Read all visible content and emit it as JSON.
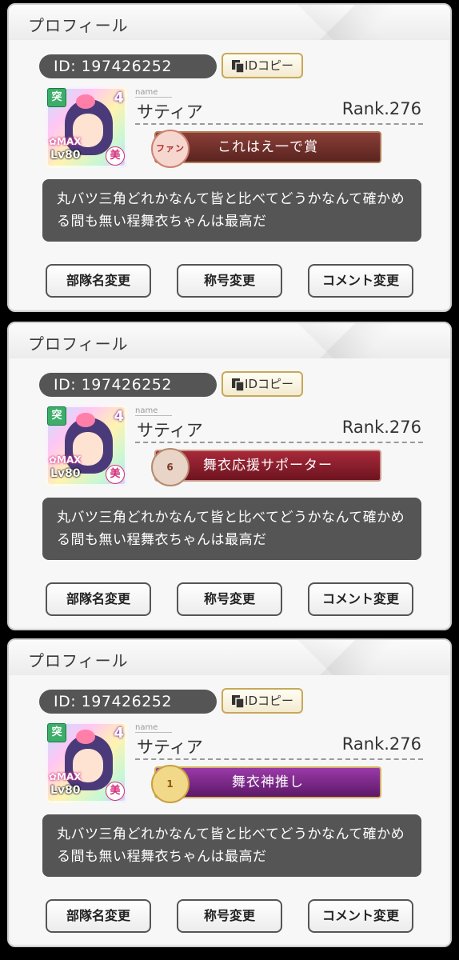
{
  "panels": [
    {
      "title": "プロフィール",
      "id_text": "ID: 197426252",
      "copy_label": "IDコピー",
      "name_caption": "name",
      "player_name": "サティア",
      "rank": "Rank.276",
      "badge_top": "突",
      "badge_num": "4",
      "max_label": "✿MAX",
      "lv_label": "Lv80",
      "attr_label": "美",
      "title_label": "これはえ一で賞",
      "title_emblem": "ファン",
      "title_color": "#6d2f2a",
      "comment": "丸バツ三角どれかなんて皆と比べてどうかなんて確かめる間も無い程舞衣ちゃんは最高だ",
      "buttons": [
        "部隊名変更",
        "称号変更",
        "コメント変更"
      ]
    },
    {
      "title": "プロフィール",
      "id_text": "ID: 197426252",
      "copy_label": "IDコピー",
      "name_caption": "name",
      "player_name": "サティア",
      "rank": "Rank.276",
      "badge_top": "突",
      "badge_num": "4",
      "max_label": "✿MAX",
      "lv_label": "Lv80",
      "attr_label": "美",
      "title_label": "舞衣応援サポーター",
      "title_emblem": "6",
      "title_color": "#8b1e2b",
      "comment": "丸バツ三角どれかなんて皆と比べてどうかなんて確かめる間も無い程舞衣ちゃんは最高だ",
      "buttons": [
        "部隊名変更",
        "称号変更",
        "コメント変更"
      ]
    },
    {
      "title": "プロフィール",
      "id_text": "ID: 197426252",
      "copy_label": "IDコピー",
      "name_caption": "name",
      "player_name": "サティア",
      "rank": "Rank.276",
      "badge_top": "突",
      "badge_num": "4",
      "max_label": "✿MAX",
      "lv_label": "Lv80",
      "attr_label": "美",
      "title_label": "舞衣神推し",
      "title_emblem": "1",
      "title_color": "#7a1f86",
      "comment": "丸バツ三角どれかなんて皆と比べてどうかなんて確かめる間も無い程舞衣ちゃんは最高だ",
      "buttons": [
        "部隊名変更",
        "称号変更",
        "コメント変更"
      ]
    }
  ]
}
